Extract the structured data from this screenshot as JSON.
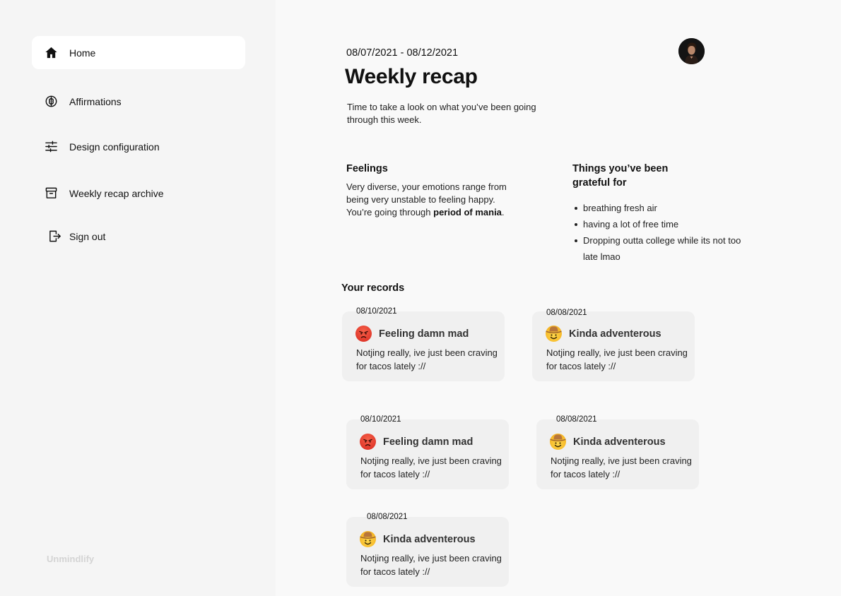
{
  "sidebar": {
    "items": [
      {
        "label": "Home",
        "icon": "home-icon",
        "active": true
      },
      {
        "label": "Affirmations",
        "icon": "brain-icon"
      },
      {
        "label": "Design configuration",
        "icon": "sliders-icon"
      },
      {
        "label": "Weekly recap archive",
        "icon": "archive-icon"
      },
      {
        "label": "Sign out",
        "icon": "sign-out-icon"
      }
    ],
    "brand": "Unmindlify"
  },
  "header": {
    "date_range": "08/07/2021 - 08/12/2021",
    "title": "Weekly recap",
    "subtitle": "Time to take a look on what you’ve been going through this week."
  },
  "feelings": {
    "title": "Feelings",
    "text": "Very diverse, your emotions range from being very unstable to feeling happy. You’re going through ",
    "bold": "period of mania",
    "end": "."
  },
  "grateful": {
    "title": "Things you’ve been grateful for",
    "items": [
      "breathing fresh air",
      "having a lot of free time",
      "Dropping outta college while its not too late lmao"
    ]
  },
  "records": {
    "title": "Your records",
    "items": [
      {
        "date": "08/10/2021",
        "emoji": "angry-face",
        "title": "Feeling damn mad",
        "body": "Notjing really, ive just been craving for tacos lately ://"
      },
      {
        "date": "08/08/2021",
        "emoji": "cowboy-face",
        "title": "Kinda adventerous",
        "body": "Notjing really, ive just been craving for tacos lately ://"
      },
      {
        "date": "08/10/2021",
        "emoji": "angry-face",
        "title": "Feeling damn mad",
        "body": "Notjing really, ive just been craving for tacos lately ://"
      },
      {
        "date": "08/08/2021",
        "emoji": "cowboy-face",
        "title": "Kinda adventerous",
        "body": "Notjing really, ive just been craving for tacos lately ://"
      },
      {
        "date": "08/08/2021",
        "emoji": "cowboy-face",
        "title": "Kinda adventerous",
        "body": "Notjing really, ive just been craving for tacos lately ://"
      }
    ]
  }
}
